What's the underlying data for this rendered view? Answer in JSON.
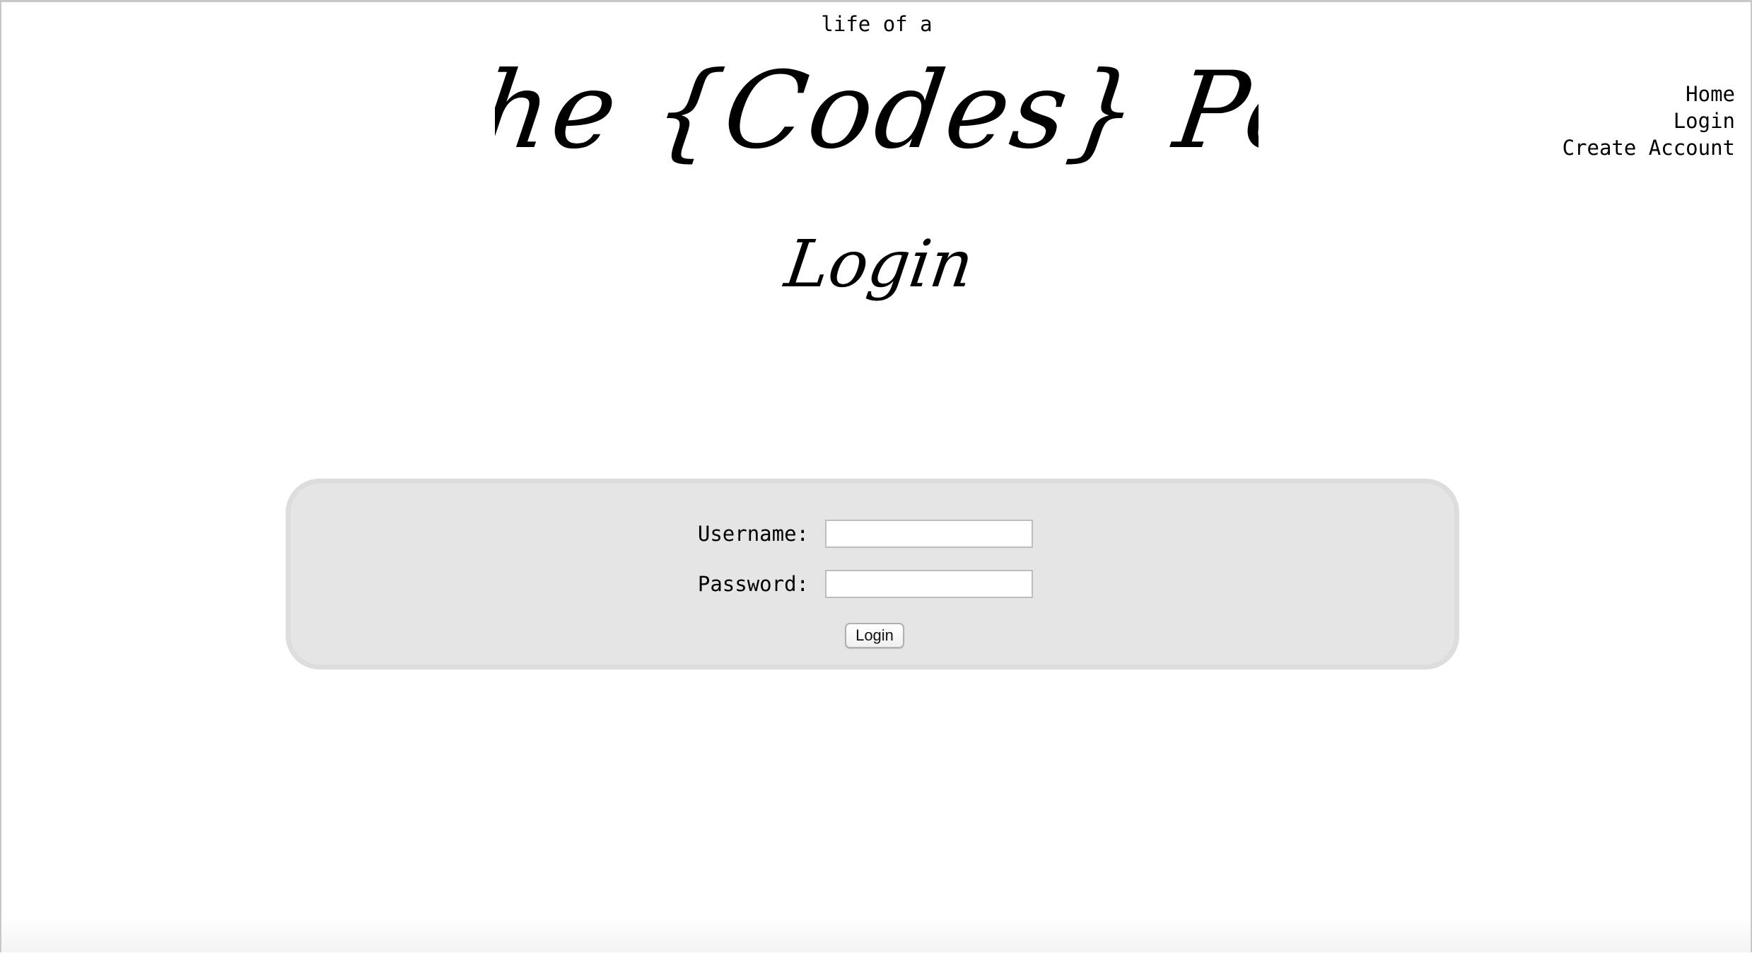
{
  "header": {
    "tagline": "life of a",
    "brand_title": "She {Codes} Pet"
  },
  "nav": {
    "items": [
      {
        "label": "Home"
      },
      {
        "label": "Login"
      },
      {
        "label": "Create Account"
      }
    ]
  },
  "page": {
    "heading": "Login"
  },
  "login_form": {
    "username_label": "Username:",
    "username_value": "",
    "password_label": "Password:",
    "password_value": "",
    "submit_label": "Login"
  },
  "colors": {
    "panel_background": "#e5e5e5",
    "panel_border": "#dddddd",
    "text": "#000000"
  }
}
